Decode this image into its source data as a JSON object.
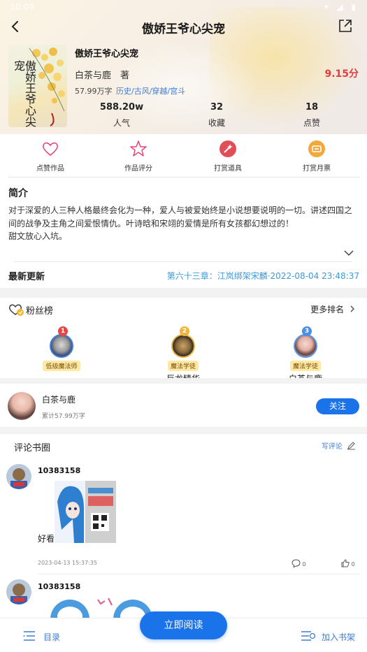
{
  "header": {
    "title": "傲娇王爷心尖宠",
    "status_time": "10:09",
    "status_icons": "▾ ◢ ▮"
  },
  "book": {
    "name": "傲娇王爷心尖宠",
    "cover_text": "傲娇王爷心尖宠",
    "author": "白茶与鹿　著",
    "score": "9.15分",
    "words": "57.99万字",
    "tags": "历史/古风/穿越/宫斗",
    "stats": [
      {
        "value": "588.20w",
        "label": "人气"
      },
      {
        "value": "32",
        "label": "收藏"
      },
      {
        "value": "18",
        "label": "点赞"
      }
    ]
  },
  "actions": [
    {
      "label": "点赞作品",
      "icon": "heart-icon"
    },
    {
      "label": "作品评分",
      "icon": "star-icon"
    },
    {
      "label": "打赏道具",
      "icon": "magic-wand-icon"
    },
    {
      "label": "打赏月票",
      "icon": "ticket-icon"
    }
  ],
  "intro": {
    "title": "简介",
    "text": "对于深爱的人三种人格最终会化为一种，爱人与被爱始终是小说想要说明的一切。讲述四国之间的战争及主角之间爱恨情仇。叶诗晗和宋翊的爱情是所有女孩都幻想过的！",
    "text2": "甜文放心入坑。"
  },
  "latest": {
    "label": "最新更新",
    "chapter": "第六十三章：江岚绑架宋麟·2022-08-04 23:48:37"
  },
  "fans": {
    "title": "粉丝榜",
    "more": "更多排名",
    "ranks": [
      {
        "rank": "1",
        "title": "低级魔法师",
        "name": ""
      },
      {
        "rank": "2",
        "title": "魔法学徒",
        "name": "巨龙精华"
      },
      {
        "rank": "3",
        "title": "魔法学徒",
        "name": "白茶与鹿"
      }
    ]
  },
  "author_card": {
    "name": "白茶与鹿",
    "sub": "累计57.99万字",
    "follow": "关注"
  },
  "comments": {
    "title": "评论书圈",
    "write": "写评论",
    "items": [
      {
        "user": "10383158",
        "text": "好看",
        "time": "2023-04-13 15:37:35",
        "replies": "0",
        "likes": "0"
      },
      {
        "user": "10383158"
      }
    ]
  },
  "bottom": {
    "toc": "目录",
    "read": "立即阅读",
    "shelf": "加入书架"
  },
  "colors": {
    "accent": "#1a73e8",
    "score": "#e23d3d",
    "link": "#3e7bd6"
  }
}
